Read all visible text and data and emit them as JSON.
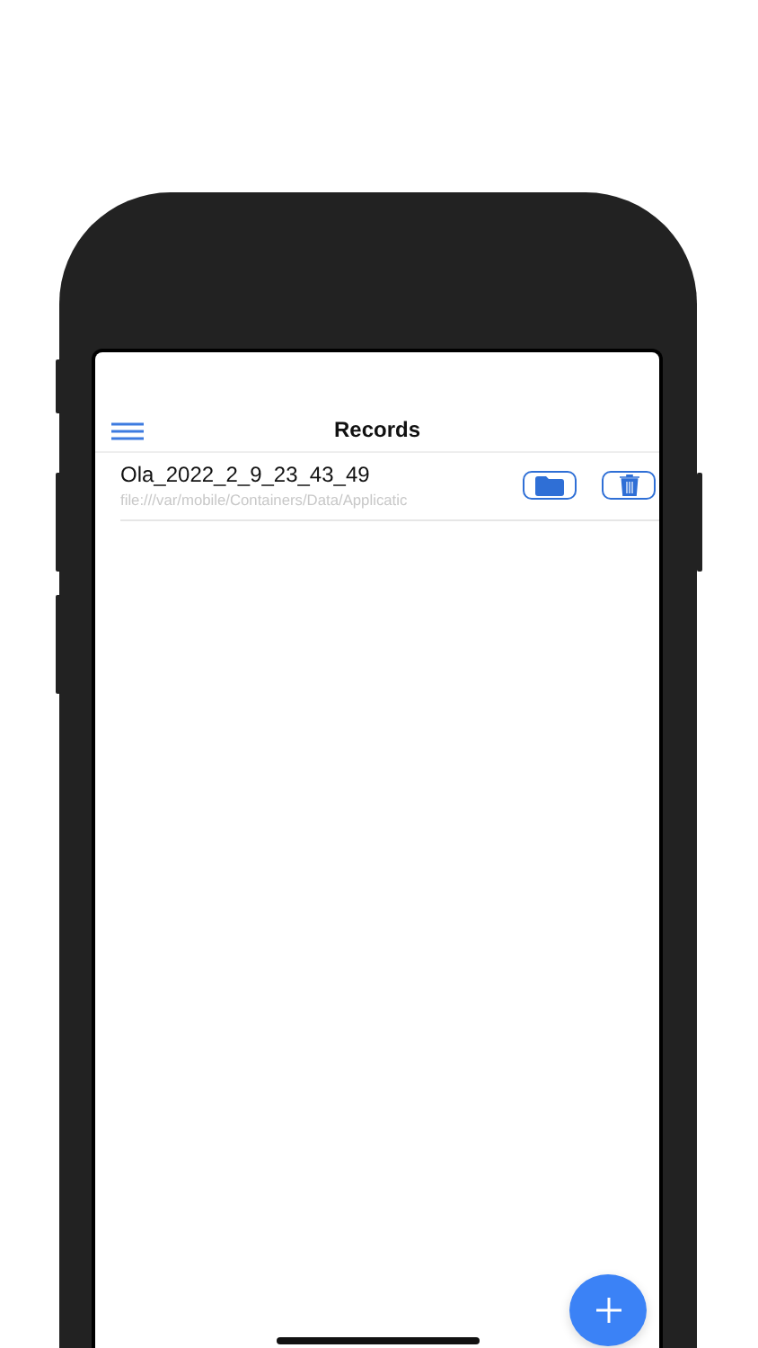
{
  "header": {
    "title": "Records"
  },
  "records": [
    {
      "name": "Ola_2022_2_9_23_43_49",
      "path": "file:///var/mobile/Containers/Data/Applicatic"
    }
  ]
}
